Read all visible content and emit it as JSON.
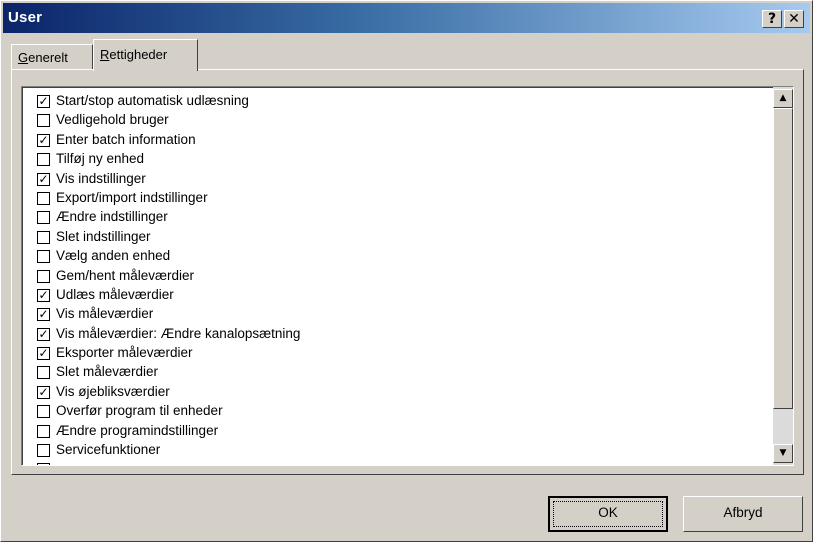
{
  "window": {
    "title": "User",
    "help_label": "?",
    "close_label": "✕"
  },
  "tabs": [
    {
      "label_ul": "G",
      "label_rest": "enerelt",
      "active": false
    },
    {
      "label_ul": "R",
      "label_rest": "ettigheder",
      "active": true
    }
  ],
  "permissions": [
    {
      "label": "Start/stop automatisk udlæsning",
      "checked": true
    },
    {
      "label": "Vedligehold bruger",
      "checked": false
    },
    {
      "label": "Enter batch information",
      "checked": true
    },
    {
      "label": "Tilføj ny enhed",
      "checked": false
    },
    {
      "label": "Vis indstillinger",
      "checked": true
    },
    {
      "label": "Export/import indstillinger",
      "checked": false
    },
    {
      "label": "Ændre indstillinger",
      "checked": false
    },
    {
      "label": "Slet indstillinger",
      "checked": false
    },
    {
      "label": "Vælg anden enhed",
      "checked": false
    },
    {
      "label": "Gem/hent måleværdier",
      "checked": false
    },
    {
      "label": "Udlæs måleværdier",
      "checked": true
    },
    {
      "label": "Vis måleværdier",
      "checked": true
    },
    {
      "label": "Vis måleværdier: Ændre kanalopsætning",
      "checked": true
    },
    {
      "label": "Eksporter måleværdier",
      "checked": true
    },
    {
      "label": "Slet måleværdier",
      "checked": false
    },
    {
      "label": "Vis øjebliksværdier",
      "checked": true
    },
    {
      "label": "Overfør program til enheder",
      "checked": false
    },
    {
      "label": "Ændre programindstillinger",
      "checked": false
    },
    {
      "label": "Servicefunktioner",
      "checked": false
    },
    {
      "label": "",
      "checked": true
    }
  ],
  "scrollbar": {
    "up_glyph": "▲",
    "down_glyph": "▼"
  },
  "buttons": {
    "ok": "OK",
    "cancel": "Afbryd"
  },
  "colors": {
    "titlebar_start": "#0a246a",
    "titlebar_end": "#a6caf0",
    "face": "#d4d0c8"
  }
}
